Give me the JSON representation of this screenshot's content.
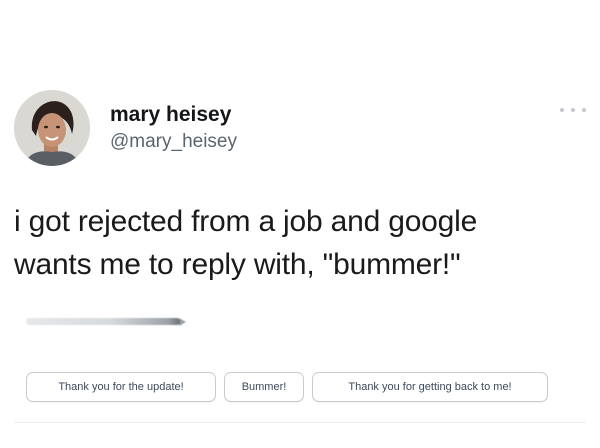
{
  "tweet": {
    "author": {
      "display_name": "mary heisey",
      "handle": "@mary_heisey",
      "avatar_icon": "profile-photo"
    },
    "more_icon": "more-horizontal-icon",
    "text_lines": [
      "i got rejected from a job and google",
      "wants me to reply with, \"bummer!\""
    ]
  },
  "smart_replies": [
    {
      "label": "Thank you for the update!"
    },
    {
      "label": "Bummer!"
    },
    {
      "label": "Thank you for getting back to me!"
    }
  ],
  "colors": {
    "text_primary": "#1a1a1a",
    "handle_gray": "#5b6570",
    "chip_border": "#c6cbd1",
    "chip_text": "#3c4a5c"
  }
}
